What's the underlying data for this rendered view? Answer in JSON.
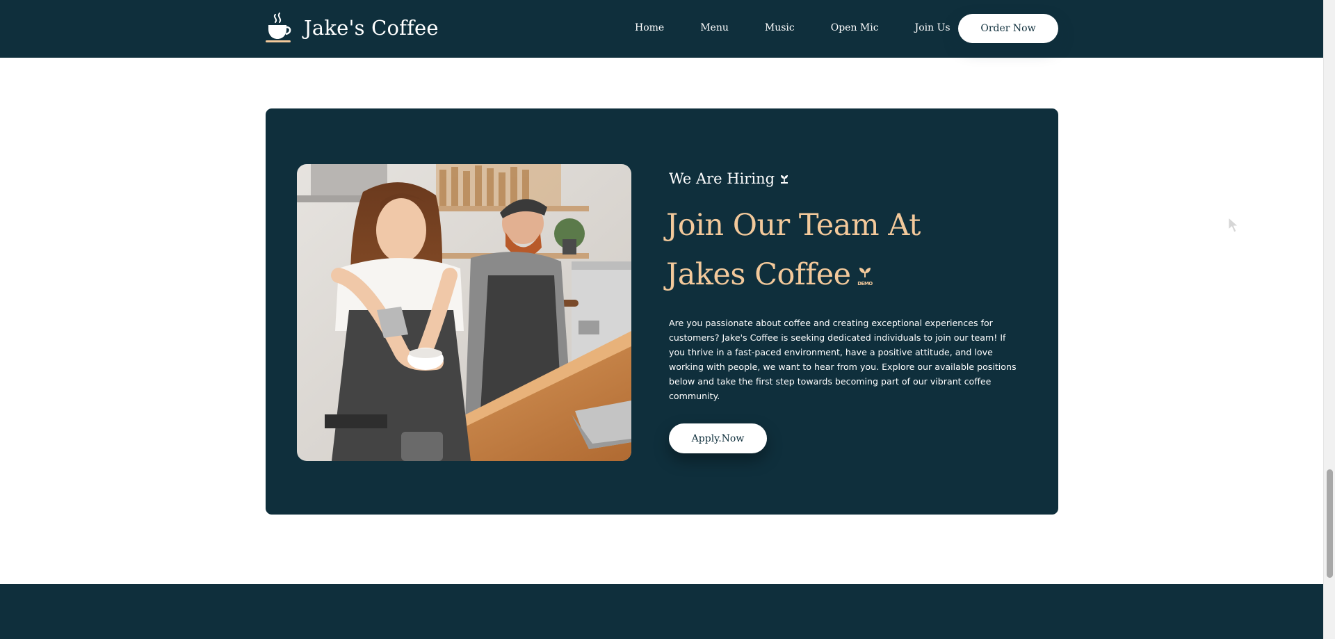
{
  "header": {
    "brand_name": "Jake's Coffee",
    "logo_icon": "coffee-cup-icon",
    "nav_items": [
      {
        "label": "Home"
      },
      {
        "label": "Menu"
      },
      {
        "label": "Music"
      },
      {
        "label": "Open Mic"
      },
      {
        "label": "Join Us"
      }
    ],
    "order_button_label": "Order Now"
  },
  "hiring": {
    "eyebrow": "We Are Hiring",
    "eyebrow_icon": "sprout-icon",
    "heading_line_1": "Join Our Team At",
    "heading_line_2": "Jakes Coffee",
    "heading_mark_text": "DEMO",
    "paragraph": "Are you passionate about coffee and creating exceptional experiences for customers? Jake's Coffee is seeking dedicated individuals to join our team! If you thrive in a fast-paced environment, have a positive attitude, and love working with people, we want to hear from you. Explore our available positions below and take the first step towards becoming part of our vibrant coffee community.",
    "apply_button_label": "Apply.Now",
    "photo_icon": "baristas-photo"
  },
  "colors": {
    "brand_dark": "#0f2f3c",
    "accent_gold": "#f3c99b",
    "white": "#ffffff"
  }
}
